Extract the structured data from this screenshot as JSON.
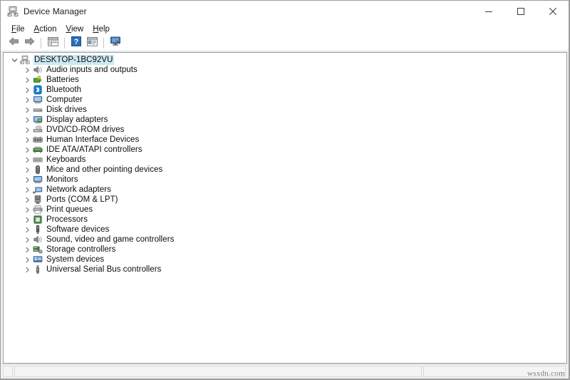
{
  "window": {
    "title": "Device Manager",
    "title_icon": "device-manager-icon",
    "controls": {
      "minimize": "Minimize",
      "maximize": "Maximize",
      "close": "Close"
    }
  },
  "menubar": {
    "items": [
      {
        "label": "File",
        "accel": "F",
        "before": "",
        "after": "ile"
      },
      {
        "label": "Action",
        "accel": "A",
        "before": "",
        "after": "ction"
      },
      {
        "label": "View",
        "accel": "V",
        "before": "",
        "after": "iew"
      },
      {
        "label": "Help",
        "accel": "H",
        "before": "",
        "after": "elp"
      }
    ]
  },
  "toolbar": {
    "buttons": [
      {
        "name": "back-button",
        "icon": "left-arrow-icon",
        "tooltip": "Back"
      },
      {
        "name": "forward-button",
        "icon": "right-arrow-icon",
        "tooltip": "Forward"
      },
      {
        "name": "show-hide-console-tree-button",
        "icon": "console-tree-icon",
        "tooltip": "Show/Hide Console Tree"
      },
      {
        "name": "help-button",
        "icon": "question-mark-icon",
        "tooltip": "Help"
      },
      {
        "name": "properties-button",
        "icon": "properties-icon",
        "tooltip": "Properties"
      },
      {
        "name": "scan-for-hardware-changes-button",
        "icon": "monitor-scan-icon",
        "tooltip": "Scan for hardware changes"
      }
    ]
  },
  "tree": {
    "root": {
      "label": "DESKTOP-1BC92VU",
      "icon": "computer-node-icon",
      "expanded": true,
      "selected": true
    },
    "children": [
      {
        "label": "Audio inputs and outputs",
        "icon": "speaker-icon",
        "expanded": false
      },
      {
        "label": "Batteries",
        "icon": "battery-icon",
        "expanded": false
      },
      {
        "label": "Bluetooth",
        "icon": "bluetooth-icon",
        "expanded": false
      },
      {
        "label": "Computer",
        "icon": "computer-icon",
        "expanded": false
      },
      {
        "label": "Disk drives",
        "icon": "disk-drive-icon",
        "expanded": false
      },
      {
        "label": "Display adapters",
        "icon": "display-adapter-icon",
        "expanded": false
      },
      {
        "label": "DVD/CD-ROM drives",
        "icon": "dvd-drive-icon",
        "expanded": false
      },
      {
        "label": "Human Interface Devices",
        "icon": "hid-icon",
        "expanded": false
      },
      {
        "label": "IDE ATA/ATAPI controllers",
        "icon": "ide-controller-icon",
        "expanded": false
      },
      {
        "label": "Keyboards",
        "icon": "keyboard-icon",
        "expanded": false
      },
      {
        "label": "Mice and other pointing devices",
        "icon": "mouse-icon",
        "expanded": false
      },
      {
        "label": "Monitors",
        "icon": "monitor-icon",
        "expanded": false
      },
      {
        "label": "Network adapters",
        "icon": "network-adapter-icon",
        "expanded": false
      },
      {
        "label": "Ports (COM & LPT)",
        "icon": "port-icon",
        "expanded": false
      },
      {
        "label": "Print queues",
        "icon": "printer-icon",
        "expanded": false
      },
      {
        "label": "Processors",
        "icon": "processor-icon",
        "expanded": false
      },
      {
        "label": "Software devices",
        "icon": "software-device-icon",
        "expanded": false
      },
      {
        "label": "Sound, video and game controllers",
        "icon": "sound-controller-icon",
        "expanded": false
      },
      {
        "label": "Storage controllers",
        "icon": "storage-controller-icon",
        "expanded": false
      },
      {
        "label": "System devices",
        "icon": "system-device-icon",
        "expanded": false
      },
      {
        "label": "Universal Serial Bus controllers",
        "icon": "usb-controller-icon",
        "expanded": false
      }
    ]
  },
  "statusbar": {
    "panel1": "",
    "panel2": "",
    "panel3": ""
  },
  "watermark": {
    "text": "wsxdn.com"
  },
  "colors": {
    "window_bg": "#ffffff",
    "chrome_bg": "#f0f0f0",
    "selection": "#cce8f4",
    "text": "#0c0c0c",
    "border": "#a0a0a0",
    "accent_blue": "#1f6fc4"
  }
}
